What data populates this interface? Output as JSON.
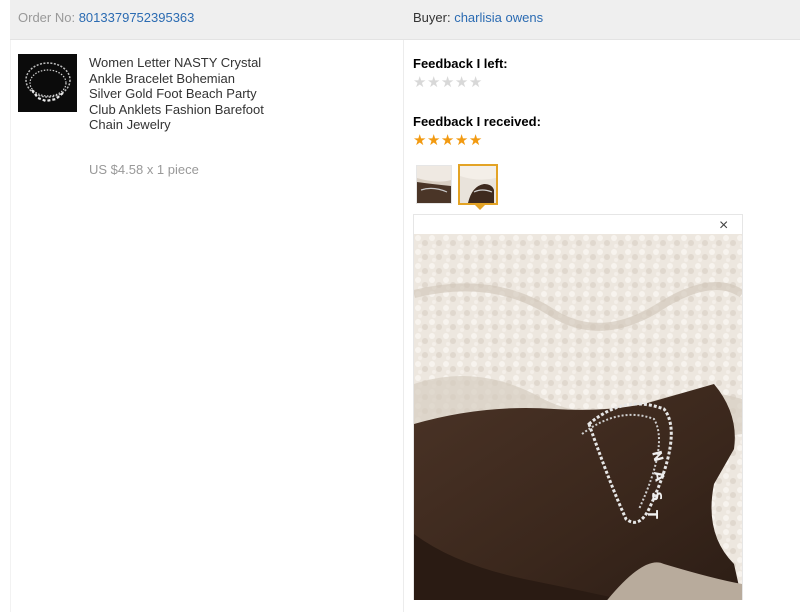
{
  "order": {
    "label": "Order No:",
    "number": "8013379752395363"
  },
  "buyer": {
    "label": "Buyer:",
    "name": "charlisia owens"
  },
  "product": {
    "title": "Women Letter NASTY Crystal Ankle Bracelet Bohemian Silver Gold Foot Beach Party Club Anklets Fashion Barefoot Chain Jewelry",
    "price": "US $4.58 x 1 piece"
  },
  "feedback_left": {
    "label": "Feedback I left:",
    "rating": 0,
    "max": 5
  },
  "feedback_received": {
    "label": "Feedback I received:",
    "rating": 5,
    "max": 5
  },
  "photos": {
    "count": 2,
    "selected": 2
  },
  "viewer": {
    "close_symbol": "×"
  },
  "colors": {
    "link": "#2b6bb2",
    "star": "#f29a11",
    "star_empty": "#d8d8d8",
    "selected_border": "#e3a325"
  }
}
